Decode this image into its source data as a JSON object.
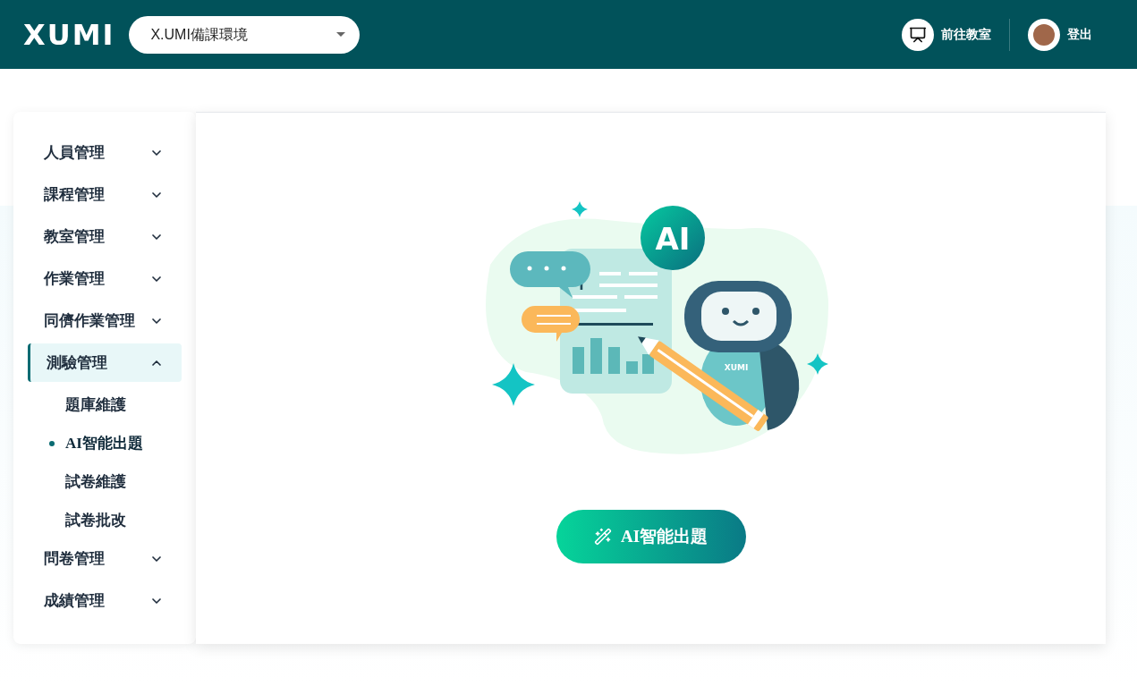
{
  "header": {
    "logo": "XUMI",
    "environment_select": {
      "value": "X.UMI備課環境"
    },
    "classroom_link": "前往教室",
    "logout_link": "登出"
  },
  "sidebar": {
    "items": [
      {
        "label": "人員管理",
        "expanded": false
      },
      {
        "label": "課程管理",
        "expanded": false
      },
      {
        "label": "教室管理",
        "expanded": false
      },
      {
        "label": "作業管理",
        "expanded": false
      },
      {
        "label": "同儕作業管理",
        "expanded": false
      },
      {
        "label": "測驗管理",
        "expanded": true,
        "children": [
          {
            "label": "題庫維護",
            "selected": false
          },
          {
            "label": "AI智能出題",
            "selected": true
          },
          {
            "label": "試卷維護",
            "selected": false
          },
          {
            "label": "試卷批改",
            "selected": false
          }
        ]
      },
      {
        "label": "問卷管理",
        "expanded": false
      },
      {
        "label": "成績管理",
        "expanded": false
      }
    ]
  },
  "main": {
    "illustration": {
      "badge": "AI",
      "robot_label": "XUMI"
    },
    "action_button": "AI智能出題"
  }
}
